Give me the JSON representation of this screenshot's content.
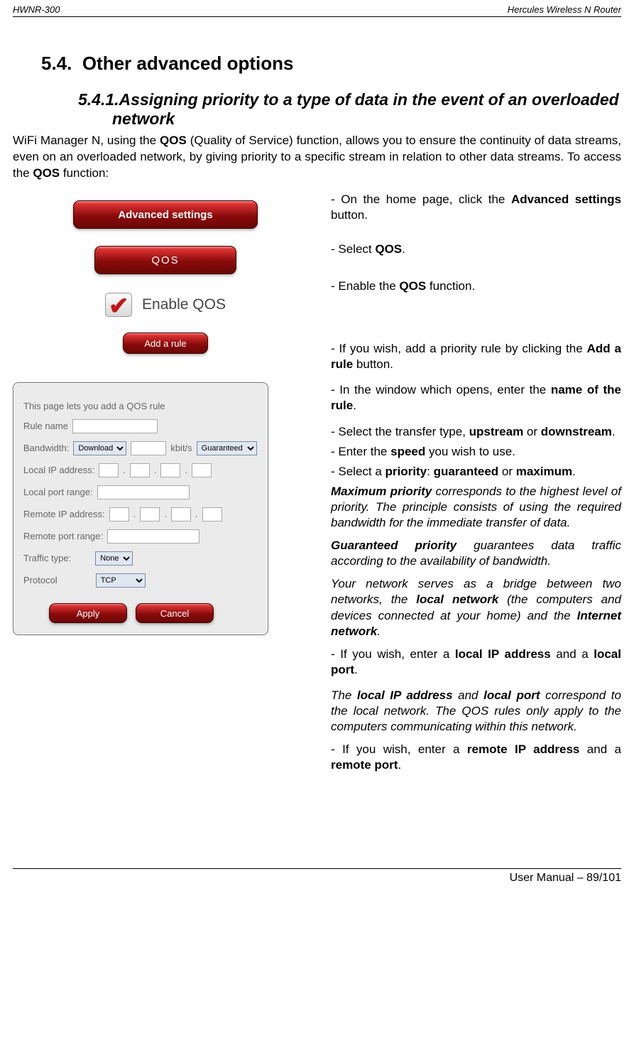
{
  "header": {
    "left": "HWNR-300",
    "right": "Hercules Wireless N Router"
  },
  "section_num": "5.4.",
  "section_title": "Other advanced options",
  "subsection_num": "5.4.1.",
  "subsection_title": "Assigning priority to a type of data in the event of an overloaded network",
  "intro_1": "WiFi Manager N, using the ",
  "intro_qos": "QOS",
  "intro_2": " (Quality of Service) function, allows you to ensure the continuity of data streams, even on an overloaded network, by giving priority to a specific stream in relation to other data streams.  To access the ",
  "intro_3": " function:",
  "buttons": {
    "advanced": "Advanced settings",
    "qos": "QOS",
    "enable_qos_label": "Enable QOS",
    "add_rule": "Add a rule",
    "apply": "Apply",
    "cancel": "Cancel"
  },
  "steps": {
    "s1a": "- On the home page, click the ",
    "s1b": "Advanced settings",
    "s1c": " button.",
    "s2a": "- Select ",
    "s2b": "QOS",
    "s2c": ".",
    "s3a": "- Enable the ",
    "s3b": "QOS",
    "s3c": " function.",
    "s4a": "- If you wish, add a priority rule by clicking the ",
    "s4b": "Add a rule",
    "s4c": " button.",
    "s5a": "- In the window which opens, enter the ",
    "s5b": "name of the rule",
    "s5c": ".",
    "s6a": "- Select the transfer type, ",
    "s6b": "upstream",
    "s6c": " or ",
    "s6d": "downstream",
    "s6e": ".",
    "s7a": "- Enter the ",
    "s7b": "speed",
    "s7c": " you wish to use.",
    "s8a": "- Select a ",
    "s8b": "priority",
    "s8c": ": ",
    "s8d": "guaranteed",
    "s8e": " or ",
    "s8f": "maximum",
    "s8g": "."
  },
  "para": {
    "p1a": "Maximum priority",
    "p1b": " corresponds to the highest level of priority.  The principle consists of using the required bandwidth for the immediate transfer of data.",
    "p2a": "Guaranteed priority",
    "p2b": " guarantees data traffic according to the availability of bandwidth.",
    "p3a": "Your network serves as a bridge between two networks, the ",
    "p3b": "local network",
    "p3c": " (the computers and devices connected at your home) and the ",
    "p3d": "Internet network",
    "p3e": ".",
    "p4a": "- If you wish, enter a ",
    "p4b": "local IP address",
    "p4c": " and a ",
    "p4d": "local port",
    "p4e": ".",
    "p5a": "The ",
    "p5b": "local IP address",
    "p5c": " and ",
    "p5d": "local port",
    "p5e": " correspond to the local network.  The QOS rules only apply to the computers communicating within this network.",
    "p6a": "- If you wish, enter a ",
    "p6b": "remote IP address",
    "p6c": " and a ",
    "p6d": "remote port",
    "p6e": "."
  },
  "form": {
    "intro": "This page lets you add a QOS rule",
    "rule_name": "Rule name",
    "bandwidth": "Bandwidth:",
    "download_opt": "Download",
    "kbits": "kbit/s",
    "guaranteed_opt": "Guaranteed",
    "local_ip": "Local IP address:",
    "local_port": "Local port range:",
    "remote_ip": "Remote IP address:",
    "remote_port": "Remote port range:",
    "traffic": "Traffic type:",
    "traffic_opt": "None",
    "protocol": "Protocol",
    "protocol_opt": "TCP"
  },
  "footer": "User Manual – 89/101"
}
